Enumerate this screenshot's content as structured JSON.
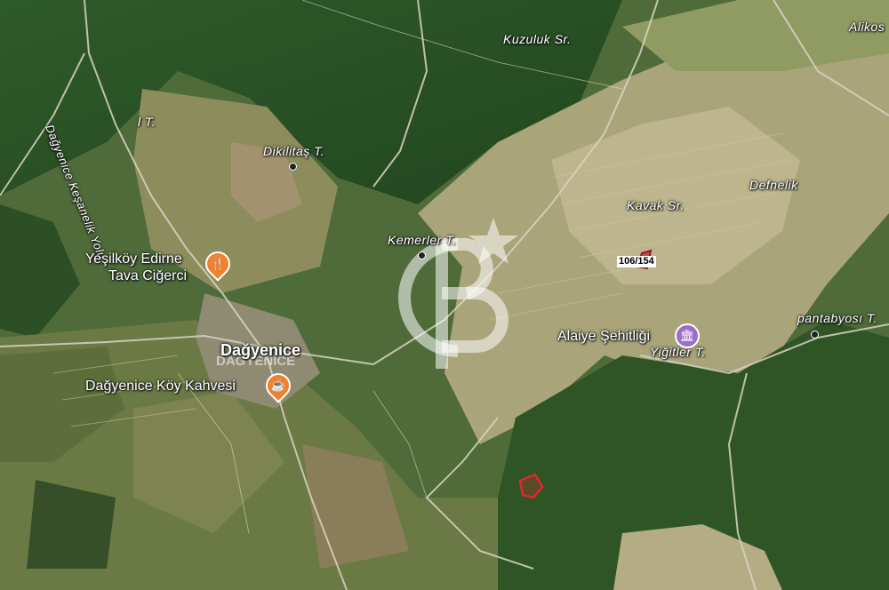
{
  "map": {
    "labels": {
      "kuzuluk": "Kuzuluk Sr.",
      "alikos": "Alikos",
      "road": "Dağyenice Keşanelik Yolu",
      "dikilitas": "Dikilitaş T.",
      "kesel": "l T.",
      "defnelik": "Defnelik",
      "kavak": "Kavak Sr.",
      "kemerler": "Kemerler T.",
      "pantabyosi": "pantabyosı T.",
      "yigitler": "Yiğitler T.",
      "dagyenice": "Dağyenice",
      "dagyenice_ghost": "DAĞYENICE"
    },
    "pois": {
      "restaurant_line1": "Yeşilköy Edirne",
      "restaurant_line2": "Tava Ciğerci",
      "cafe": "Dağyenice Köy Kahvesi",
      "memorial": "Alaiye Şehitliği"
    },
    "parcel_label": "106/154",
    "colors": {
      "restaurant_pin": "#f0822d",
      "cafe_pin": "#f0822d",
      "memorial_pin": "#9b6fc9",
      "parcel_outline": "#e3262b",
      "parcel_outline_dark": "#a0142a"
    },
    "icons": {
      "restaurant": "fork-knife-icon",
      "cafe": "coffee-cup-icon",
      "memorial": "monument-icon"
    }
  }
}
